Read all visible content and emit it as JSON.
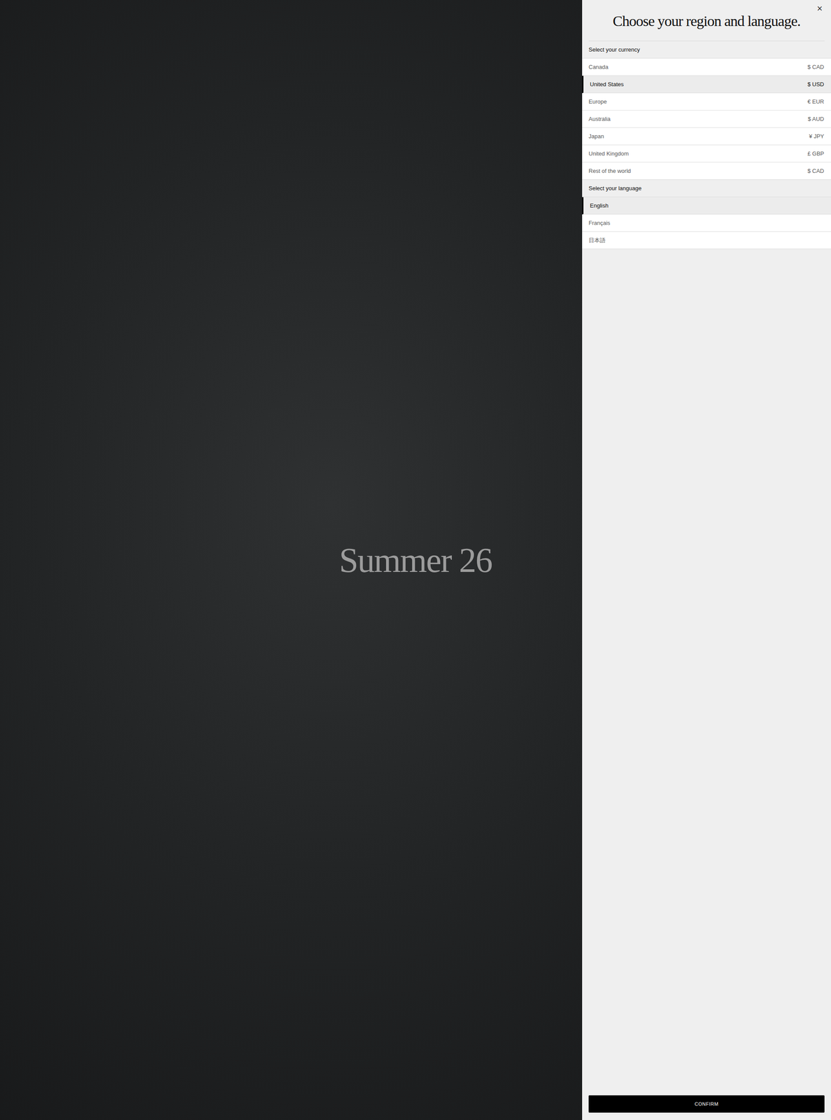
{
  "hero": {
    "title": "Summer 26"
  },
  "panel": {
    "title": "Choose your region and language.",
    "close": "×",
    "currency_header": "Select your currency",
    "regions": [
      {
        "name": "Canada",
        "currency": "$ CAD",
        "selected": false
      },
      {
        "name": "United States",
        "currency": "$ USD",
        "selected": true
      },
      {
        "name": "Europe",
        "currency": "€ EUR",
        "selected": false
      },
      {
        "name": "Australia",
        "currency": "$ AUD",
        "selected": false
      },
      {
        "name": "Japan",
        "currency": "¥ JPY",
        "selected": false
      },
      {
        "name": "United Kingdom",
        "currency": "£ GBP",
        "selected": false
      },
      {
        "name": "Rest of the world",
        "currency": "$ CAD",
        "selected": false
      }
    ],
    "language_header": "Select your language",
    "languages": [
      {
        "name": "English",
        "selected": true
      },
      {
        "name": "Français",
        "selected": false
      },
      {
        "name": "日本語",
        "selected": false
      }
    ],
    "confirm": "CONFIRM"
  }
}
